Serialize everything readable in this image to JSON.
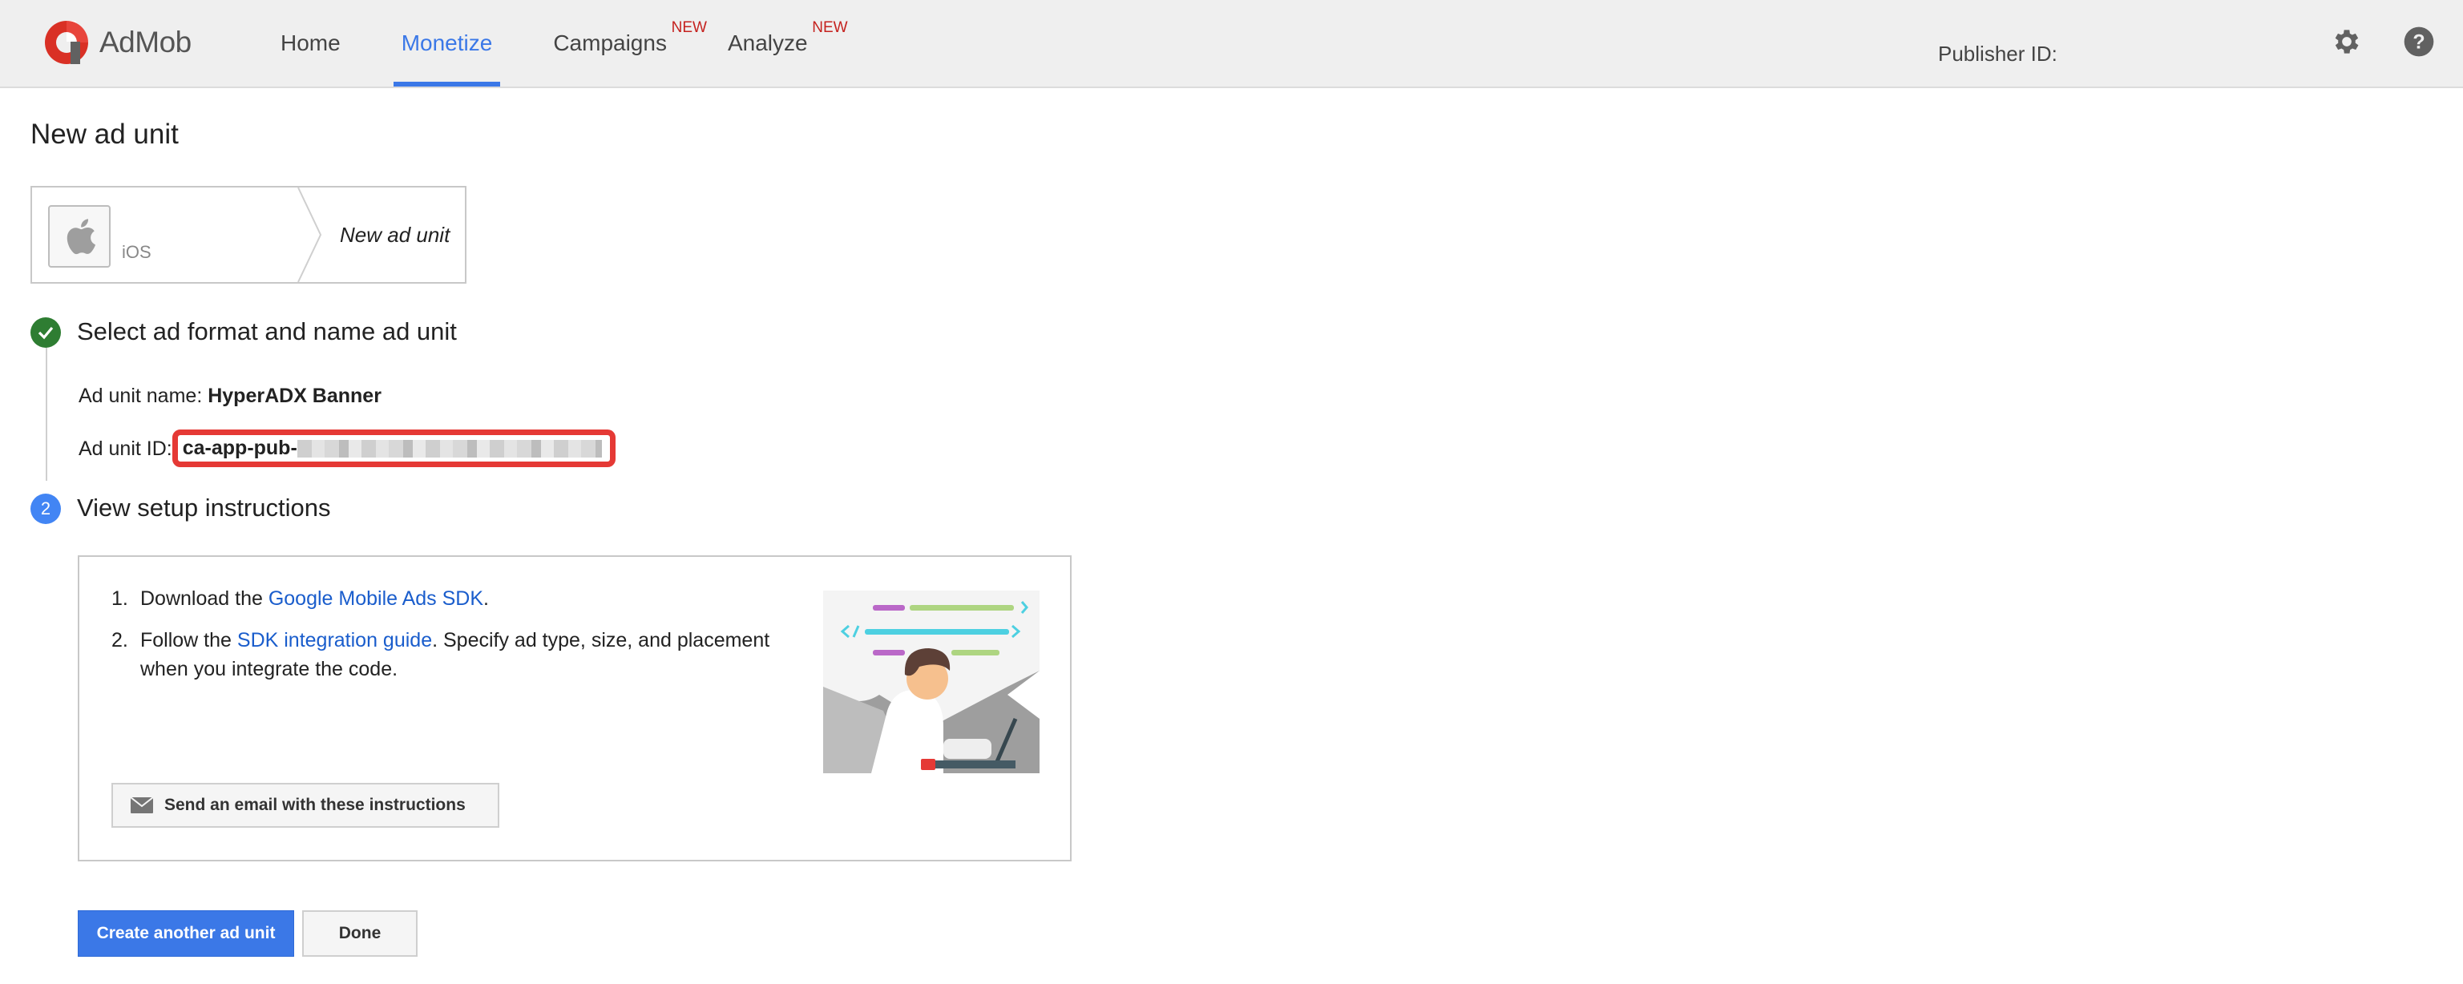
{
  "header": {
    "app_name": "AdMob",
    "nav": [
      {
        "label": "Home",
        "badge": ""
      },
      {
        "label": "Monetize",
        "badge": ""
      },
      {
        "label": "Campaigns",
        "badge": "NEW"
      },
      {
        "label": "Analyze",
        "badge": "NEW"
      }
    ],
    "active_nav": "Monetize",
    "publisher_label": "Publisher ID:",
    "icons": [
      "gear-icon",
      "help-icon"
    ],
    "accent_color": "#3b78e7"
  },
  "page": {
    "title": "New ad unit",
    "breadcrumb": {
      "platform_icon": "apple-icon",
      "platform": "iOS",
      "current": "New ad unit"
    }
  },
  "steps": [
    {
      "status": "complete",
      "title": "Select ad format and name ad unit",
      "ad_unit_name_label": "Ad unit name:",
      "ad_unit_name": "HyperADX Banner",
      "ad_unit_id_label": "Ad unit ID:",
      "ad_unit_id_prefix": "ca-app-pub-"
    },
    {
      "number": "2",
      "title": "View setup instructions"
    }
  ],
  "instructions": {
    "items": [
      {
        "num": "1.",
        "before": "Download the ",
        "link": "Google Mobile Ads SDK",
        "after": "."
      },
      {
        "num": "2.",
        "before": "Follow the ",
        "link": "SDK integration guide",
        "after": ". Specify ad type, size, and placement when you integrate the code."
      }
    ],
    "email_button": "Send an email with these instructions"
  },
  "actions": {
    "create_another": "Create another ad unit",
    "done": "Done"
  }
}
